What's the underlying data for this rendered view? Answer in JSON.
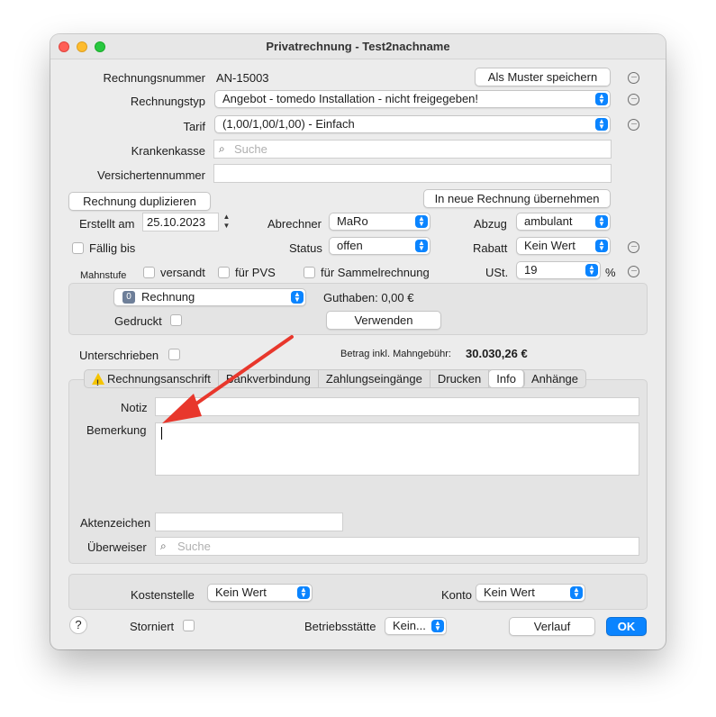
{
  "window": {
    "title": "Privatrechnung - Test2nachname"
  },
  "header": {
    "rechnungsnummer_label": "Rechnungsnummer",
    "rechnungsnummer_value": "AN-15003",
    "als_muster_button": "Als Muster speichern",
    "rechnungstyp_label": "Rechnungstyp",
    "rechnungstyp_value": "Angebot - tomedo Installation - nicht freigegeben!",
    "tarif_label": "Tarif",
    "tarif_value": "(1,00/1,00/1,00) - Einfach",
    "krankenkasse_label": "Krankenkasse",
    "krankenkasse_placeholder": "Suche",
    "versichertennummer_label": "Versichertennummer",
    "versichertennummer_value": ""
  },
  "actions": {
    "duplizieren_button": "Rechnung duplizieren",
    "uebernehmen_button": "In neue Rechnung übernehmen"
  },
  "details": {
    "erstellt_label": "Erstellt am",
    "erstellt_value": "25.10.2023",
    "abrechner_label": "Abrechner",
    "abrechner_value": "MaRo",
    "abzug_label": "Abzug",
    "abzug_value": "ambulant",
    "faellig_label": "Fällig bis",
    "status_label": "Status",
    "status_value": "offen",
    "rabatt_label": "Rabatt",
    "rabatt_value": "Kein Wert",
    "mahnstufe_label": "Mahnstufe",
    "versandt_label": "versandt",
    "fuer_pvs_label": "für PVS",
    "sammelrechnung_label": "für Sammelrechnung",
    "ust_label": "USt.",
    "ust_value": "19",
    "ust_unit": "%"
  },
  "document_box": {
    "type_value": "Rechnung",
    "type_badge": "0",
    "guthaben_label": "Guthaben: 0,00 €",
    "verwenden_button": "Verwenden",
    "gedruckt_label": "Gedruckt"
  },
  "summary": {
    "unterschrieben_label": "Unterschrieben",
    "betrag_label": "Betrag inkl. Mahngebühr:",
    "betrag_value": "30.030,26 €"
  },
  "tabs": [
    {
      "label": "Rechnungsanschrift"
    },
    {
      "label": "Bankverbindung"
    },
    {
      "label": "Zahlungseingänge"
    },
    {
      "label": "Drucken"
    },
    {
      "label": "Info"
    },
    {
      "label": "Anhänge"
    }
  ],
  "info": {
    "notiz_label": "Notiz",
    "notiz_value": "",
    "bemerkung_label": "Bemerkung",
    "bemerkung_value": "",
    "aktenzeichen_label": "Aktenzeichen",
    "aktenzeichen_value": "",
    "ueberweiser_label": "Überweiser",
    "ueberweiser_placeholder": "Suche"
  },
  "footer": {
    "kostenstelle_label": "Kostenstelle",
    "kostenstelle_value": "Kein Wert",
    "konto_label": "Konto",
    "konto_value": "Kein Wert",
    "help_label": "?",
    "storniert_label": "Storniert",
    "betriebsstaette_label": "Betriebsstätte",
    "betriebsstaette_value": "Kein...",
    "verlauf_button": "Verlauf",
    "ok_button": "OK"
  },
  "colors": {
    "accent": "#0a84ff",
    "annotation_arrow": "#e8372c"
  }
}
